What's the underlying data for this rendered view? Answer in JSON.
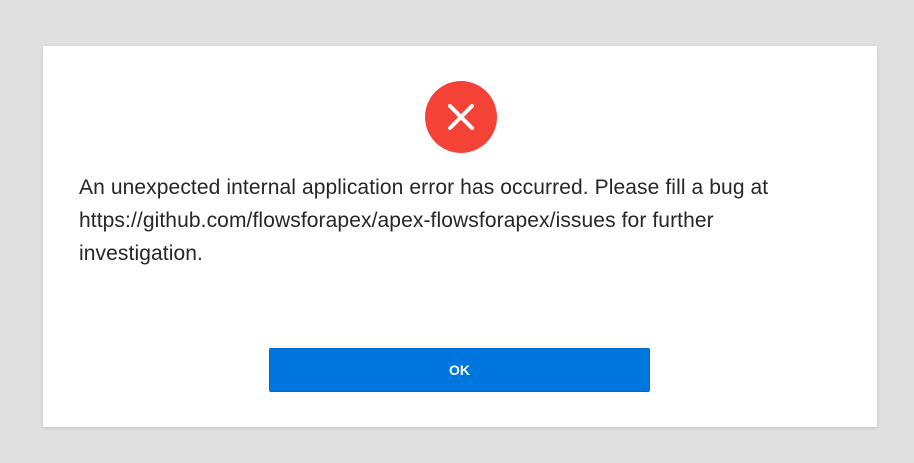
{
  "dialog": {
    "icon": "error-x-icon",
    "icon_color": "#f44336",
    "message": "An unexpected internal application error has occurred. Please fill a bug at https://github.com/flowsforapex/apex-flowsforapex/issues for further investigation.",
    "ok_label": "OK",
    "button_color": "#0076df"
  }
}
